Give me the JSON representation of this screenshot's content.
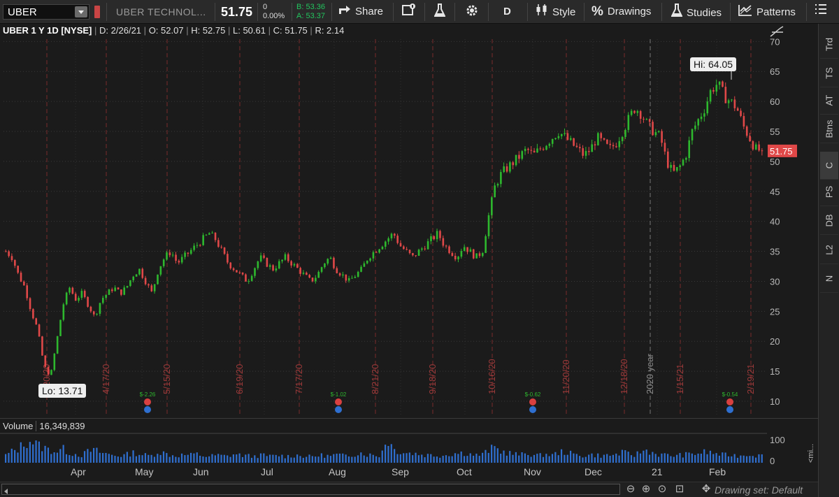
{
  "toolbar": {
    "symbol": "UBER",
    "company": "UBER TECHNOL...",
    "last": "51.75",
    "change": "0",
    "change_pct": "0.00%",
    "bid": "B: 53.36",
    "ask": "A: 53.37",
    "share": "Share",
    "aggregation": "D",
    "style": "Style",
    "drawings": "Drawings",
    "studies": "Studies",
    "patterns": "Patterns"
  },
  "header": {
    "title": "UBER 1 Y 1D [NYSE]",
    "date": "D: 2/26/21",
    "open": "O: 52.07",
    "high": "H: 52.75",
    "low": "L: 50.61",
    "close": "C: 51.75",
    "range": "R: 2.14"
  },
  "right_tabs": [
    "Trd",
    "TS",
    "AT",
    "Btns",
    "C",
    "PS",
    "DB",
    "L2",
    "N"
  ],
  "active_tab": "C",
  "volume": {
    "label": "Volume",
    "value": "16,349,839",
    "axis_top": "100",
    "axis_bottom": "0",
    "side_label": "<mi..."
  },
  "x_axis": [
    "Apr",
    "May",
    "Jun",
    "Jul",
    "Aug",
    "Sep",
    "Oct",
    "Nov",
    "Dec",
    "21",
    "Feb"
  ],
  "footer": {
    "drawing_set": "Drawing set: Default"
  },
  "chart_data": {
    "type": "candlestick",
    "y_ticks": [
      10,
      15,
      20,
      25,
      30,
      35,
      40,
      45,
      50,
      55,
      60,
      65,
      70
    ],
    "ylim": [
      8,
      72
    ],
    "hi_label": "Hi: 64.05",
    "lo_label": "Lo: 13.71",
    "last_label": "51.75",
    "date_markers": [
      "3/20/20",
      "4/17/20",
      "5/15/20",
      "6/19/20",
      "7/17/20",
      "8/21/20",
      "9/18/20",
      "10/16/20",
      "11/20/20",
      "12/18/20",
      "2020 year",
      "1/15/21",
      "2/19/21"
    ],
    "earnings": [
      "$-2.26",
      "$-1.02",
      "$-0.62",
      "$-0.54"
    ],
    "path": [
      35,
      34,
      31,
      29,
      25,
      22,
      16,
      14,
      20,
      26,
      29,
      27,
      28,
      26,
      24,
      27,
      28,
      29,
      28,
      29,
      31,
      32,
      30,
      28,
      32,
      34,
      35,
      33,
      34,
      35,
      36,
      37,
      38,
      37,
      35,
      33,
      32,
      31,
      30,
      32,
      34,
      33,
      32,
      33,
      34,
      33,
      32,
      31,
      30,
      31,
      33,
      34,
      32,
      31,
      30,
      31,
      32,
      34,
      35,
      36,
      37,
      38,
      36,
      35,
      34,
      35,
      36,
      37,
      38,
      36,
      35,
      34,
      36,
      35,
      34,
      35,
      41,
      46,
      48,
      49,
      50,
      51,
      52,
      51,
      52,
      53,
      54,
      55,
      54,
      53,
      52,
      51,
      52,
      54,
      53,
      52,
      53,
      55,
      57,
      59,
      58,
      56,
      55,
      54,
      50,
      48,
      49,
      51,
      55,
      57,
      59,
      62,
      63,
      61,
      60,
      59,
      56,
      54,
      52,
      51.75
    ],
    "volume_profile": [
      30,
      45,
      55,
      80,
      90,
      70,
      60,
      50,
      45,
      55,
      40,
      35,
      30,
      45,
      50,
      40,
      35,
      30,
      28,
      32,
      40,
      35,
      30,
      28,
      45,
      38,
      30,
      28,
      32,
      30,
      35,
      28,
      25,
      30,
      28,
      26,
      35,
      30,
      28,
      25,
      30,
      28,
      26,
      30,
      25,
      28,
      30,
      26,
      24,
      28,
      30,
      26,
      32,
      28,
      30,
      35,
      40,
      32,
      30,
      28,
      100,
      55,
      45,
      40,
      38,
      35,
      30,
      32,
      28,
      30,
      35,
      38,
      40,
      35,
      30,
      32,
      50,
      60,
      45,
      40,
      35,
      30,
      38,
      32,
      28,
      35,
      30,
      40,
      45,
      35,
      30,
      28,
      32,
      30,
      28,
      30,
      32,
      40,
      35,
      30,
      45,
      50,
      38,
      32,
      30,
      28,
      30,
      32,
      35,
      38,
      42,
      40,
      35,
      30,
      32,
      28,
      30,
      35,
      30,
      28
    ]
  }
}
